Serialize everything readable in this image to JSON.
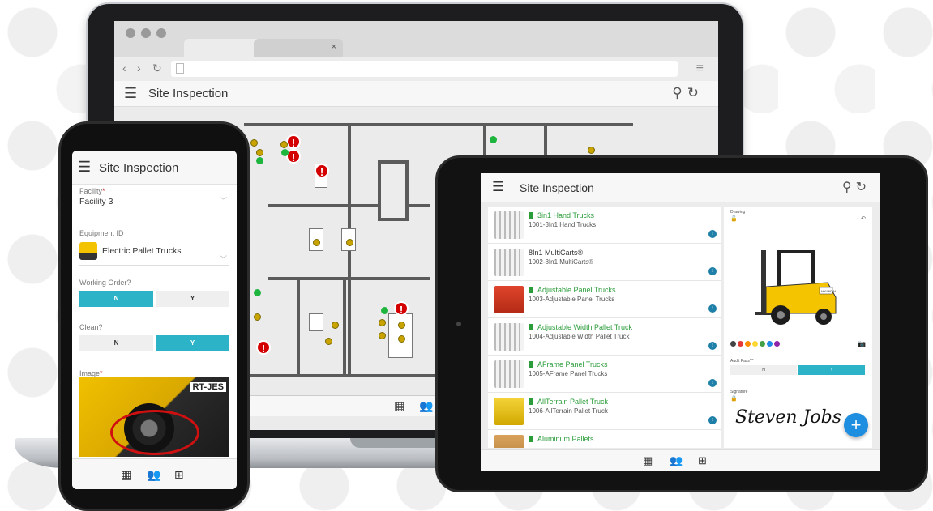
{
  "laptop": {
    "tab_close_1": "×",
    "tab_close_2": "×",
    "nav": {
      "back": "‹",
      "forward": "›",
      "reload": "↻",
      "menu": "≡"
    },
    "app_title": "Site Inspection",
    "icons": {
      "menu": "hamburger-icon",
      "search": "search-icon",
      "refresh": "refresh-icon",
      "calendar": "calendar-icon",
      "users": "users-icon"
    }
  },
  "phone": {
    "app_title": "Site Inspection",
    "facility": {
      "label": "Facility",
      "required_mark": "*",
      "value": "Facility 3"
    },
    "equipment": {
      "label": "Equipment ID",
      "value": "Electric Pallet Trucks"
    },
    "working_order": {
      "label": "Working Order?",
      "options": [
        "N",
        "Y"
      ],
      "selected": "N"
    },
    "clean": {
      "label": "Clean?",
      "options": [
        "N",
        "Y"
      ],
      "selected": "Y"
    },
    "image": {
      "label": "Image",
      "required_mark": "*",
      "brand_text": "RT-JES"
    },
    "icons": {
      "calendar": "calendar-icon",
      "users": "users-icon",
      "grid": "grid-icon"
    }
  },
  "tablet": {
    "app_title": "Site Inspection",
    "items": [
      {
        "name": "3in1 Hand Trucks",
        "sub": "1001-3In1 Hand Trucks",
        "tagged": true
      },
      {
        "name": "8In1 MultiCarts®",
        "sub": "1002-8In1 MultiCarts®",
        "tagged": false
      },
      {
        "name": "Adjustable Panel Trucks",
        "sub": "1003-Adjustable Panel Trucks",
        "tagged": true
      },
      {
        "name": "Adjustable Width Pallet Truck",
        "sub": "1004-Adjustable Width Pallet Truck",
        "tagged": true
      },
      {
        "name": "AFrame Panel Trucks",
        "sub": "1005-AFrame Panel Trucks",
        "tagged": true
      },
      {
        "name": "AllTerrain Pallet Truck",
        "sub": "1006-AllTerrain Pallet Truck",
        "tagged": true
      },
      {
        "name": "Aluminum Pallets",
        "sub": "",
        "tagged": true
      }
    ],
    "detail": {
      "drawing_label": "Drawing",
      "forklift_brand": "HYUNDAI",
      "swatch_colors": [
        "#444444",
        "#e53935",
        "#fb8c00",
        "#fdd835",
        "#43a047",
        "#1e88e5",
        "#8e24aa"
      ],
      "audit_label": "Audit Pass?*",
      "audit_options": [
        "N",
        "Y"
      ],
      "audit_selected": "Y",
      "signature_label": "Signature",
      "signature_text": "Steven Jobs"
    },
    "fab_label": "+",
    "accent": "#2cb3c8",
    "icons": {
      "calendar": "calendar-icon",
      "users": "users-icon",
      "grid": "grid-icon"
    }
  }
}
